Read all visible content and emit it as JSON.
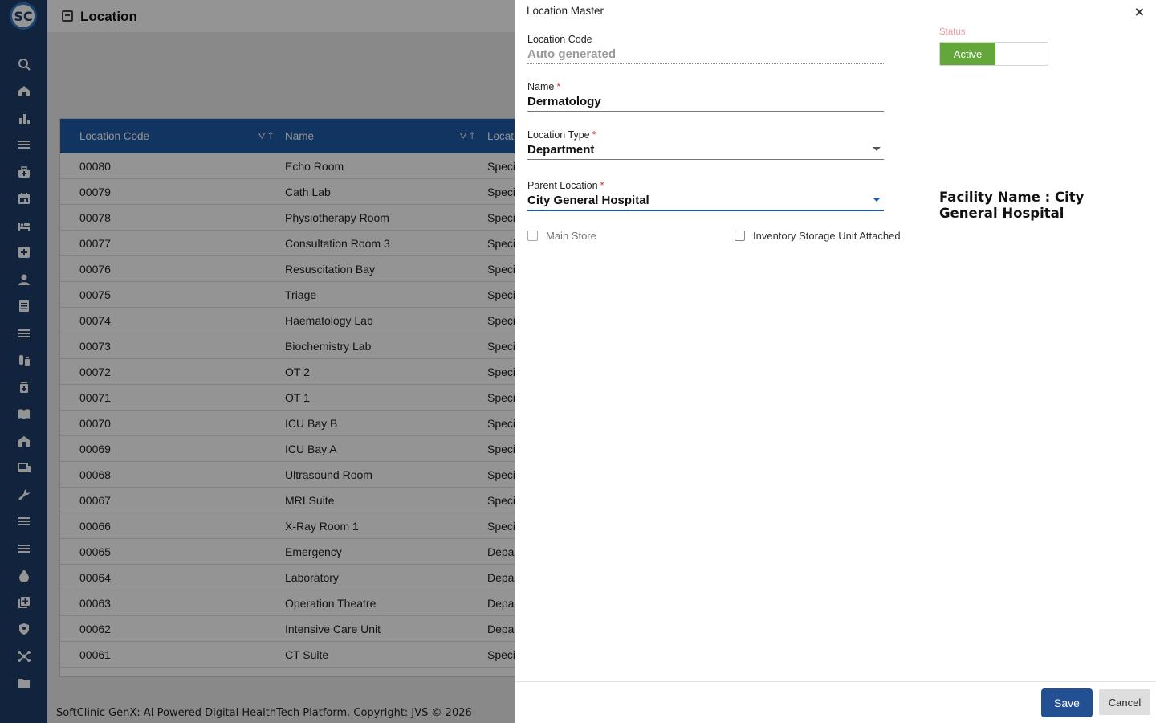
{
  "app": {
    "logo_text": "SC",
    "page_title": "Location"
  },
  "sidebar": {
    "icons": [
      "search-icon",
      "home-icon",
      "bar-chart-icon",
      "menu-icon",
      "medical-bag-icon",
      "calendar-icon",
      "bed-icon",
      "plus-box-icon",
      "person-icon",
      "document-icon",
      "list-icon",
      "pharmacy-icon",
      "medicine-icon",
      "book-icon",
      "building-icon",
      "devices-icon",
      "wrench-icon",
      "list-icon",
      "list-icon",
      "drop-icon",
      "add-library-icon",
      "shield-icon",
      "network-icon",
      "folder-icon"
    ]
  },
  "grid": {
    "columns": {
      "code": "Location Code",
      "name": "Name",
      "type": "Locati"
    },
    "rows": [
      [
        "00080",
        "Echo Room",
        "Speci"
      ],
      [
        "00079",
        "Cath Lab",
        "Speci"
      ],
      [
        "00078",
        "Physiotherapy Room",
        "Speci"
      ],
      [
        "00077",
        "Consultation Room 3",
        "Speci"
      ],
      [
        "00076",
        "Resuscitation Bay",
        "Speci"
      ],
      [
        "00075",
        "Triage",
        "Speci"
      ],
      [
        "00074",
        "Haematology Lab",
        "Speci"
      ],
      [
        "00073",
        "Biochemistry Lab",
        "Speci"
      ],
      [
        "00072",
        "OT 2",
        "Speci"
      ],
      [
        "00071",
        "OT 1",
        "Speci"
      ],
      [
        "00070",
        "ICU Bay B",
        "Speci"
      ],
      [
        "00069",
        "ICU Bay A",
        "Speci"
      ],
      [
        "00068",
        "Ultrasound Room",
        "Speci"
      ],
      [
        "00067",
        "MRI Suite",
        "Speci"
      ],
      [
        "00066",
        "X-Ray Room 1",
        "Speci"
      ],
      [
        "00065",
        "Emergency",
        "Depa"
      ],
      [
        "00064",
        "Laboratory",
        "Depa"
      ],
      [
        "00063",
        "Operation Theatre",
        "Depa"
      ],
      [
        "00062",
        "Intensive Care Unit",
        "Depa"
      ],
      [
        "00061",
        "CT Suite",
        "Speci"
      ]
    ]
  },
  "footer": {
    "text": "SoftClinic GenX: AI Powered Digital HealthTech Platform. Copyright: JVS © 2026"
  },
  "dialog": {
    "title": "Location Master",
    "close": "×",
    "location_code": {
      "label": "Location Code",
      "value": "Auto generated"
    },
    "name": {
      "label": "Name",
      "required": "*",
      "value": "Dermatology"
    },
    "location_type": {
      "label": "Location Type",
      "required": "*",
      "value": "Department"
    },
    "parent_location": {
      "label": "Parent Location",
      "required": "*",
      "value": "City General Hospital"
    },
    "status": {
      "label": "Status",
      "value": "Active"
    },
    "facility": "Facility Name : City General Hospital",
    "main_store": {
      "label": "Main Store",
      "checked": false
    },
    "inventory_unit": {
      "label": "Inventory Storage Unit Attached",
      "checked": false
    },
    "save": "Save",
    "cancel": "Cancel"
  },
  "colors": {
    "sidebar": "#1f3d6b",
    "grid_header": "#1f5aa6",
    "save_button": "#234f93",
    "status_active": "#63a63a"
  }
}
